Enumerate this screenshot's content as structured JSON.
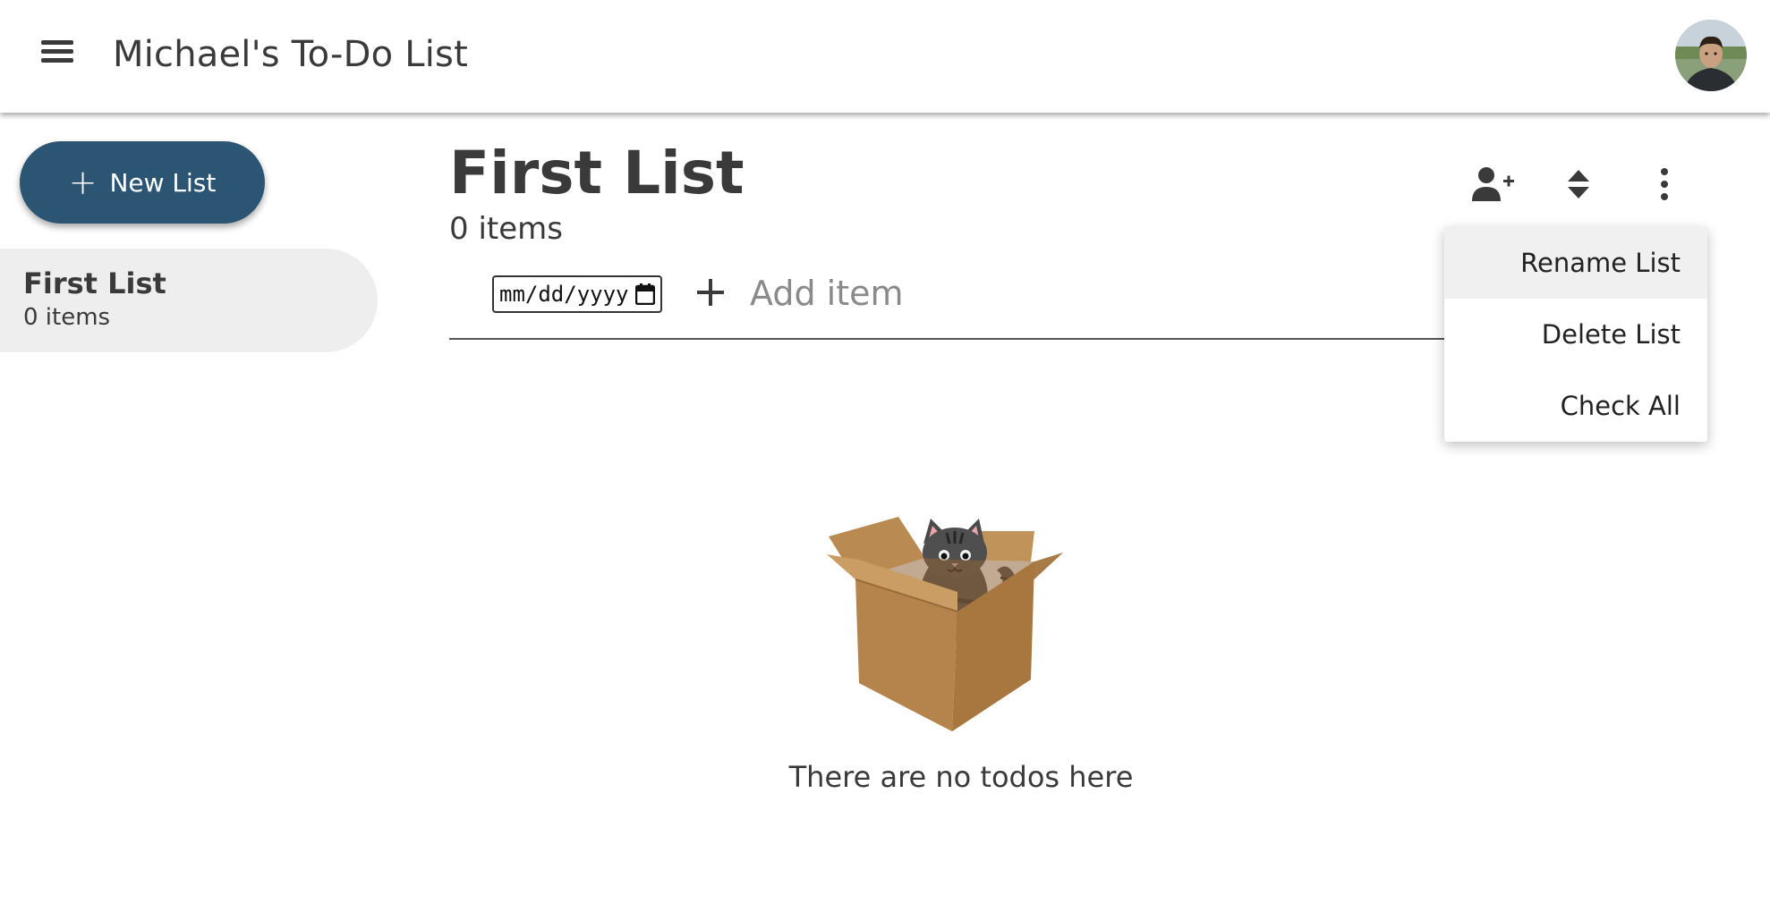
{
  "header": {
    "title": "Michael's To-Do List",
    "menu_icon": "hamburger-menu-icon",
    "avatar_icon": "user-avatar"
  },
  "sidebar": {
    "new_list_label": "New List",
    "lists": [
      {
        "name": "First List",
        "count": "0 items",
        "selected": true
      }
    ]
  },
  "main": {
    "title": "First List",
    "count": "0 items",
    "actions": [
      "add-person-icon",
      "sort-icon",
      "more-vert-icon"
    ],
    "date_input_placeholder": "mm/dd/yyyy",
    "add_item_placeholder": "Add item",
    "empty_text": "There are no todos here",
    "empty_illustration": "cat-in-box"
  },
  "dropdown": {
    "items": [
      "Rename List",
      "Delete List",
      "Check All"
    ],
    "highlighted_index": 0
  },
  "colors": {
    "accent": "#2b5573",
    "text": "#3a3a3a",
    "sidebar_selected_bg": "#eeeeee",
    "box": "#b88a52"
  }
}
